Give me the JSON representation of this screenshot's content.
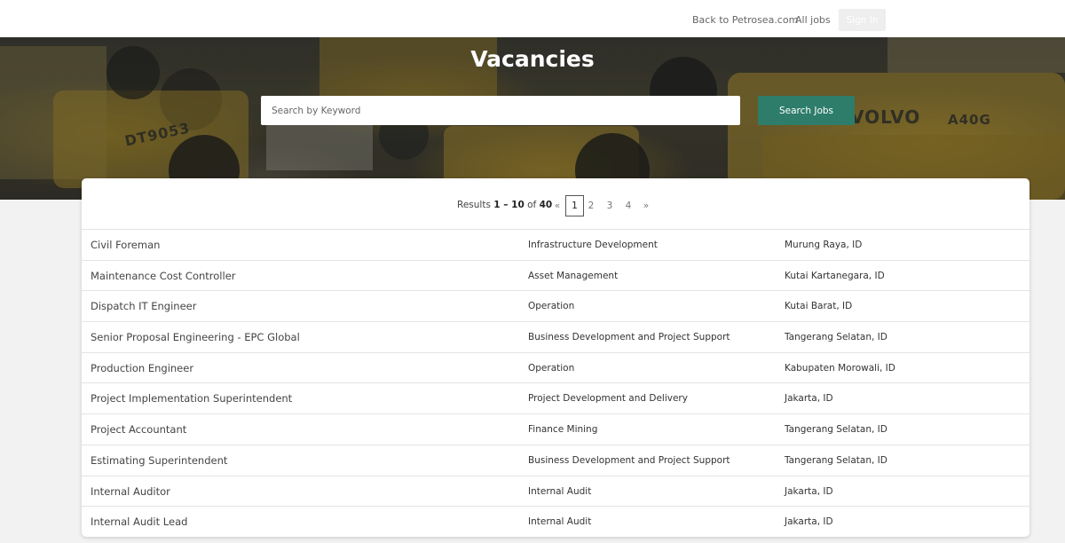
{
  "nav": {
    "back_label": "Back to Petrosea.com",
    "all_jobs_label": "All jobs",
    "signin_label": "Sign In"
  },
  "hero": {
    "title": "Vacancies",
    "search_placeholder": "Search by Keyword",
    "search_button_label": "Search Jobs"
  },
  "pagination": {
    "results_prefix": "Results",
    "range": "1 – 10",
    "of_word": "of",
    "total": "40",
    "prev": "«",
    "pages": [
      "1",
      "2",
      "3",
      "4"
    ],
    "current_page": "1",
    "next": "»"
  },
  "jobs": [
    {
      "title": "Civil Foreman",
      "department": "Infrastructure Development",
      "location": "Murung Raya, ID"
    },
    {
      "title": "Maintenance Cost Controller",
      "department": "Asset Management",
      "location": "Kutai Kartanegara, ID"
    },
    {
      "title": "Dispatch IT Engineer",
      "department": "Operation",
      "location": "Kutai Barat, ID"
    },
    {
      "title": "Senior Proposal Engineering - EPC Global",
      "department": "Business Development and Project Support",
      "location": "Tangerang Selatan, ID"
    },
    {
      "title": "Production Engineer",
      "department": "Operation",
      "location": "Kabupaten Morowali, ID"
    },
    {
      "title": "Project Implementation Superintendent",
      "department": "Project Development and Delivery",
      "location": "Jakarta, ID"
    },
    {
      "title": "Project Accountant",
      "department": "Finance Mining",
      "location": "Tangerang Selatan, ID"
    },
    {
      "title": "Estimating Superintendent",
      "department": "Business Development and Project Support",
      "location": "Tangerang Selatan, ID"
    },
    {
      "title": "Internal Auditor",
      "department": "Internal Audit",
      "location": "Jakarta, ID"
    },
    {
      "title": "Internal Audit Lead",
      "department": "Internal Audit",
      "location": "Jakarta, ID"
    }
  ],
  "colors": {
    "accent": "#2e7d6a",
    "hero_overlay": "#2a2f33"
  }
}
